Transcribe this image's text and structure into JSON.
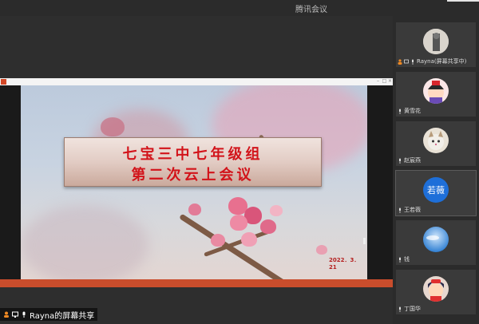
{
  "app": {
    "title": "腾讯会议"
  },
  "presentation": {
    "title_line1": "七宝三中七年级组",
    "title_line2": "第二次云上会议",
    "date": "2022．3．21"
  },
  "share": {
    "label": "Rayna的屏幕共享"
  },
  "participants": [
    {
      "name": "Rayna(屏幕共享中)",
      "avatar": "photo-avatar-icon"
    },
    {
      "name": "黄雪花",
      "avatar": "cartoon-avatar-icon"
    },
    {
      "name": "赵宸燕",
      "avatar": "cat-avatar-icon"
    },
    {
      "name": "王若薇",
      "avatar_text": "若薇"
    },
    {
      "name": "钱",
      "avatar": "sky-avatar-icon"
    },
    {
      "name": "丁国华",
      "avatar": "cartoon-girl-avatar-icon"
    }
  ],
  "colors": {
    "accent": "#1e6fd9",
    "title_red": "#d2131a",
    "ppt_orange": "#c94d2c"
  }
}
